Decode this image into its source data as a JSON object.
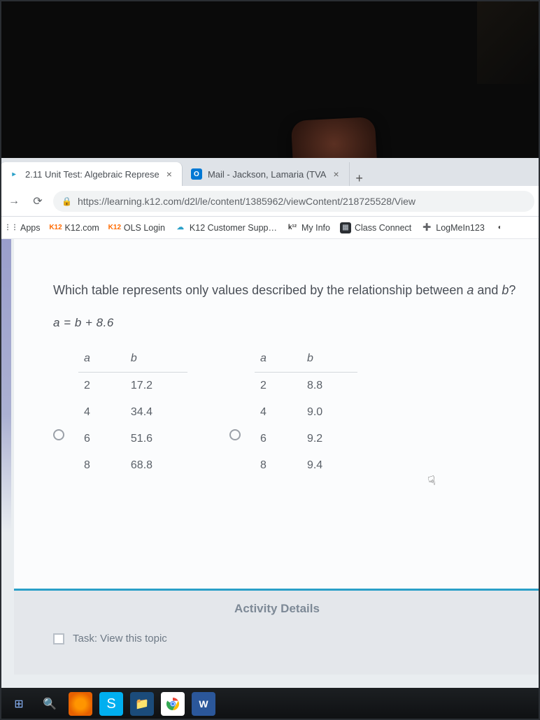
{
  "tabs": [
    {
      "title": "2.11 Unit Test: Algebraic Represe",
      "favicon_bg": "#ffffff",
      "favicon_fg": "#2aa0c8",
      "favicon_txt": "▸",
      "active": true
    },
    {
      "title": "Mail - Jackson, Lamaria (TVA",
      "favicon_bg": "#0078d4",
      "favicon_fg": "#ffffff",
      "favicon_txt": "O",
      "active": false
    }
  ],
  "newtab_glyph": "+",
  "nav": {
    "fwd": "→",
    "reload": "⟳"
  },
  "url": "https://learning.k12.com/d2l/le/content/1385962/viewContent/218725528/View",
  "lock_glyph": "🔒",
  "bookmarks": [
    {
      "label": "Apps",
      "ico_txt": "⋮⋮",
      "ico_bg": "transparent",
      "ico_fg": "#5f6368"
    },
    {
      "label": "K12.com",
      "ico_txt": "K12",
      "ico_bg": "transparent",
      "ico_fg": "#ff6a00"
    },
    {
      "label": "OLS Login",
      "ico_txt": "K12",
      "ico_bg": "transparent",
      "ico_fg": "#ff6a00"
    },
    {
      "label": "K12 Customer Supp…",
      "ico_txt": "☁",
      "ico_bg": "transparent",
      "ico_fg": "#2aa0c8"
    },
    {
      "label": "My Info",
      "ico_txt": "k¹²",
      "ico_bg": "transparent",
      "ico_fg": "#333"
    },
    {
      "label": "Class Connect",
      "ico_txt": "▦",
      "ico_bg": "#2a2e33",
      "ico_fg": "#9aa0a8"
    },
    {
      "label": "LogMeIn123",
      "ico_txt": "➕",
      "ico_bg": "transparent",
      "ico_fg": "#2aa0c8"
    },
    {
      "label": "",
      "ico_txt": "◐",
      "ico_bg": "transparent",
      "ico_fg": "#333"
    }
  ],
  "question_pre": "Which table represents only values described by the relationship between ",
  "var_a": "a",
  "question_mid": " and ",
  "var_b": "b",
  "question_post": "?",
  "equation": "a = b + 8.6",
  "col_a": "a",
  "col_b": "b",
  "tableA": [
    {
      "a": "2",
      "b": "17.2"
    },
    {
      "a": "4",
      "b": "34.4"
    },
    {
      "a": "6",
      "b": "51.6"
    },
    {
      "a": "8",
      "b": "68.8"
    }
  ],
  "tableB": [
    {
      "a": "2",
      "b": "8.8"
    },
    {
      "a": "4",
      "b": "9.0"
    },
    {
      "a": "6",
      "b": "9.2"
    },
    {
      "a": "8",
      "b": "9.4"
    }
  ],
  "cursor_glyph": "☟",
  "activity_heading": "Activity Details",
  "task_label": "Task: View this topic",
  "taskbar": {
    "win": "⊞",
    "search": "🔍",
    "ff": "",
    "skype": "S",
    "fm": "📁",
    "chrome": "◉",
    "word": "W"
  }
}
